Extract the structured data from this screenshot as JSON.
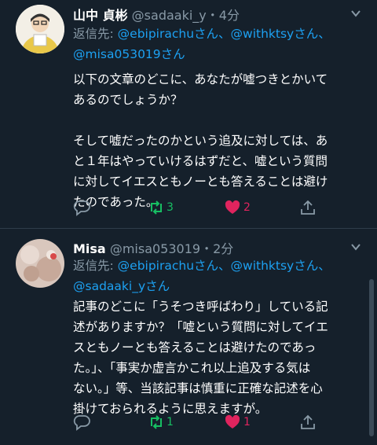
{
  "tweets": [
    {
      "display_name": "山中 貞彬",
      "handle": "@sadaaki_y",
      "sep": "・",
      "time": "4分",
      "reply_prefix": "返信先: ",
      "mentions": [
        "@ebipirachuさん",
        "、",
        "@withktsyさん",
        "、",
        "@misa053019さん"
      ],
      "text": "以下の文章のどこに、あなたが嘘つきとかいて\nあるのでしょうか？\n\nそして嘘だったのかという追及に対しては、あ\nと１年はやっていけるはずだと、嘘という質問\nに対してイエスともノーとも答えることは避け\nたのであった。",
      "retweets": "3",
      "likes": "2",
      "liked": true,
      "colors": {
        "retweet": "#17bf63",
        "like": "#e0245e"
      }
    },
    {
      "display_name": "Misa",
      "handle": "@misa053019",
      "sep": "・",
      "time": "2分",
      "reply_prefix": "返信先: ",
      "mentions": [
        "@ebipirachuさん",
        "、",
        "@withktsyさん",
        "、",
        "@sadaaki_yさん"
      ],
      "text": "記事のどこに「うそつき呼ばわり」している記\n述がありますか？「嘘という質問に対してイエ\nスともノーとも答えることは避けたのであっ\nた。」、「事実か虚言かこれ以上追及する気は\nない。」等、当該記事は慎重に正確な記述を心\n掛けておられるように思えますが。",
      "retweets": "1",
      "likes": "1",
      "liked": true,
      "colors": {
        "retweet": "#17bf63",
        "like": "#e0245e"
      }
    }
  ],
  "theme": {
    "background": "#15202b",
    "muted": "#8899a6",
    "link": "#1da1f2"
  },
  "icons": [
    "reply-icon",
    "retweet-icon",
    "heart-icon",
    "share-icon",
    "chevron-down-icon"
  ]
}
